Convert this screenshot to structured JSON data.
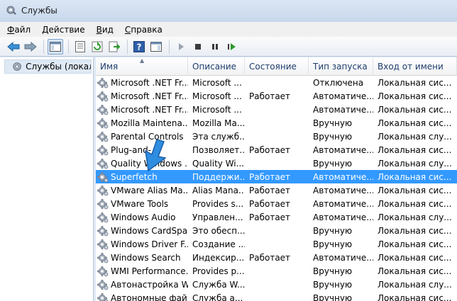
{
  "window": {
    "title": "Службы"
  },
  "menu": [
    {
      "label_u": "Ф",
      "label_rest": "айл"
    },
    {
      "label_u": "Д",
      "label_rest": "ействие"
    },
    {
      "label_u": "В",
      "label_rest": "ид"
    },
    {
      "label_u": "С",
      "label_rest": "правка"
    }
  ],
  "tree": {
    "item": "Службы (локаль"
  },
  "columns": [
    "Имя",
    "Описание",
    "Состояние",
    "Тип запуска",
    "Вход от имени"
  ],
  "rows": [
    {
      "name": "Microsoft .NET Fr...",
      "desc": "Microsoft ...",
      "state": "",
      "start": "Отключена",
      "logon": "Локальная сис..."
    },
    {
      "name": "Microsoft .NET Fr...",
      "desc": "Microsoft ...",
      "state": "Работает",
      "start": "Автоматиче...",
      "logon": "Локальная сис..."
    },
    {
      "name": "Microsoft .NET Fr...",
      "desc": "Microsoft ...",
      "state": "",
      "start": "Автоматиче...",
      "logon": "Локальная сис..."
    },
    {
      "name": "Mozilla Maintena...",
      "desc": "Mozilla Ma...",
      "state": "",
      "start": "Вручную",
      "logon": "Локальная сис..."
    },
    {
      "name": "Parental Controls",
      "desc": "Эта служб...",
      "state": "",
      "start": "Вручную",
      "logon": "Локальная слу..."
    },
    {
      "name": "Plug-and-...",
      "desc": "Позволяет...",
      "state": "Работает",
      "start": "Автоматиче...",
      "logon": "Локальная сис..."
    },
    {
      "name": "Quality Windows ...",
      "desc": "Quality Wi...",
      "state": "",
      "start": "Вручную",
      "logon": "Локальная слу..."
    },
    {
      "name": "Superfetch",
      "desc": "Поддержи...",
      "state": "Работает",
      "start": "Автоматиче...",
      "logon": "Локальная сис...",
      "selected": true
    },
    {
      "name": "VMware Alias Ma...",
      "desc": "Alias Mana...",
      "state": "Работает",
      "start": "Автоматиче...",
      "logon": "Локальная сис..."
    },
    {
      "name": "VMware Tools",
      "desc": "Provides s...",
      "state": "Работает",
      "start": "Автоматиче...",
      "logon": "Локальная сис..."
    },
    {
      "name": "Windows Audio",
      "desc": "Управлен...",
      "state": "Работает",
      "start": "Автоматиче...",
      "logon": "Локальная слу..."
    },
    {
      "name": "Windows CardSpa...",
      "desc": "Это обесп...",
      "state": "",
      "start": "Вручную",
      "logon": "Локальная сис..."
    },
    {
      "name": "Windows Driver F...",
      "desc": "Создание ...",
      "state": "",
      "start": "Вручную",
      "logon": "Локальная сис..."
    },
    {
      "name": "Windows Search",
      "desc": "Индексир...",
      "state": "Работает",
      "start": "Автоматиче...",
      "logon": "Локальная сис..."
    },
    {
      "name": "WMI Performance...",
      "desc": "Provides p...",
      "state": "",
      "start": "Вручную",
      "logon": "Локальная сис..."
    },
    {
      "name": "Автонастройка W...",
      "desc": "Служба W...",
      "state": "",
      "start": "Вручную",
      "logon": "Локальная слу..."
    },
    {
      "name": "Автономные фай...",
      "desc": "Служба а...",
      "state": "",
      "start": "Вручную",
      "logon": "Локальная сис..."
    }
  ],
  "colors": {
    "selection": "#3399ff",
    "accent_arrow": "#2f8de0"
  }
}
